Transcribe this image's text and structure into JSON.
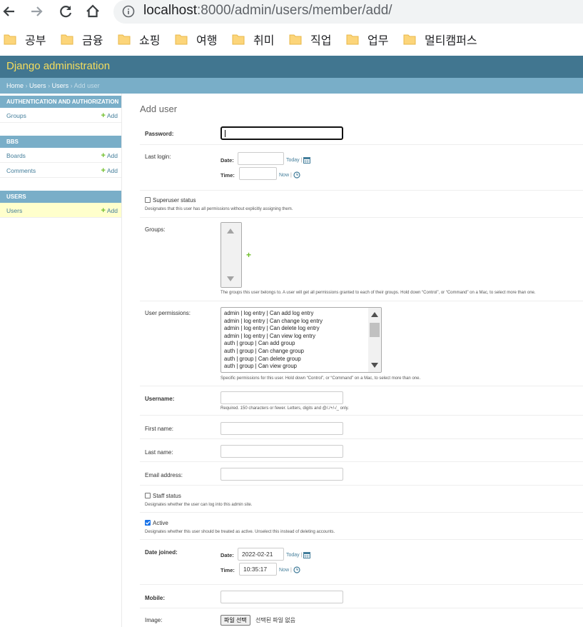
{
  "browser": {
    "url_host": "localhost",
    "url_path": ":8000/admin/users/member/add/",
    "bookmarks": [
      "공부",
      "금융",
      "쇼핑",
      "여행",
      "취미",
      "직업",
      "업무",
      "멀티캠퍼스"
    ]
  },
  "header": {
    "brand": "Django administration"
  },
  "breadcrumbs": {
    "home": "Home",
    "app": "Users",
    "model": "Users",
    "current": "Add user",
    "sep": "›"
  },
  "sidebar": {
    "modules": [
      {
        "caption": "Authentication and Authorization",
        "models": [
          {
            "name": "Groups",
            "add": "Add"
          }
        ]
      },
      {
        "caption": "BBS",
        "models": [
          {
            "name": "Boards",
            "add": "Add"
          },
          {
            "name": "Comments",
            "add": "Add"
          }
        ]
      },
      {
        "caption": "Users",
        "models": [
          {
            "name": "Users",
            "add": "Add"
          }
        ]
      }
    ]
  },
  "form": {
    "title": "Add user",
    "password_label": "Password:",
    "last_login_label": "Last login:",
    "date_label": "Date:",
    "time_label": "Time:",
    "today": "Today",
    "now": "Now",
    "superuser_label": "Superuser status",
    "superuser_help": "Designates that this user has all permissions without explicitly assigning them.",
    "groups_label": "Groups:",
    "groups_help": "The groups this user belongs to. A user will get all permissions granted to each of their groups. Hold down “Control”, or “Command” on a Mac, to select more than one.",
    "user_permissions_label": "User permissions:",
    "user_permissions_options": [
      "admin | log entry | Can add log entry",
      "admin | log entry | Can change log entry",
      "admin | log entry | Can delete log entry",
      "admin | log entry | Can view log entry",
      "auth | group | Can add group",
      "auth | group | Can change group",
      "auth | group | Can delete group",
      "auth | group | Can view group"
    ],
    "user_permissions_help": "Specific permissions for this user. Hold down “Control”, or “Command” on a Mac, to select more than one.",
    "username_label": "Username:",
    "username_help": "Required. 150 characters or fewer. Letters, digits and @/./+/-/_ only.",
    "first_name_label": "First name:",
    "last_name_label": "Last name:",
    "email_label": "Email address:",
    "staff_label": "Staff status",
    "staff_help": "Designates whether the user can log into this admin site.",
    "active_label": "Active",
    "active_checked": true,
    "active_help": "Designates whether this user should be treated as active. Unselect this instead of deleting accounts.",
    "date_joined_label": "Date joined:",
    "date_joined_date": "2022-02-21",
    "date_joined_time": "10:35:17",
    "mobile_label": "Mobile:",
    "image_label": "Image:",
    "file_button": "파일 선택",
    "file_none": "선택된 파일 없음"
  },
  "colors": {
    "header_bg": "#417690",
    "brand": "#f5dd5d",
    "breadcrumbs_bg": "#79aec8",
    "link": "#447e9b",
    "add_green": "#70bf2b",
    "selected_row": "#ffffcc"
  }
}
